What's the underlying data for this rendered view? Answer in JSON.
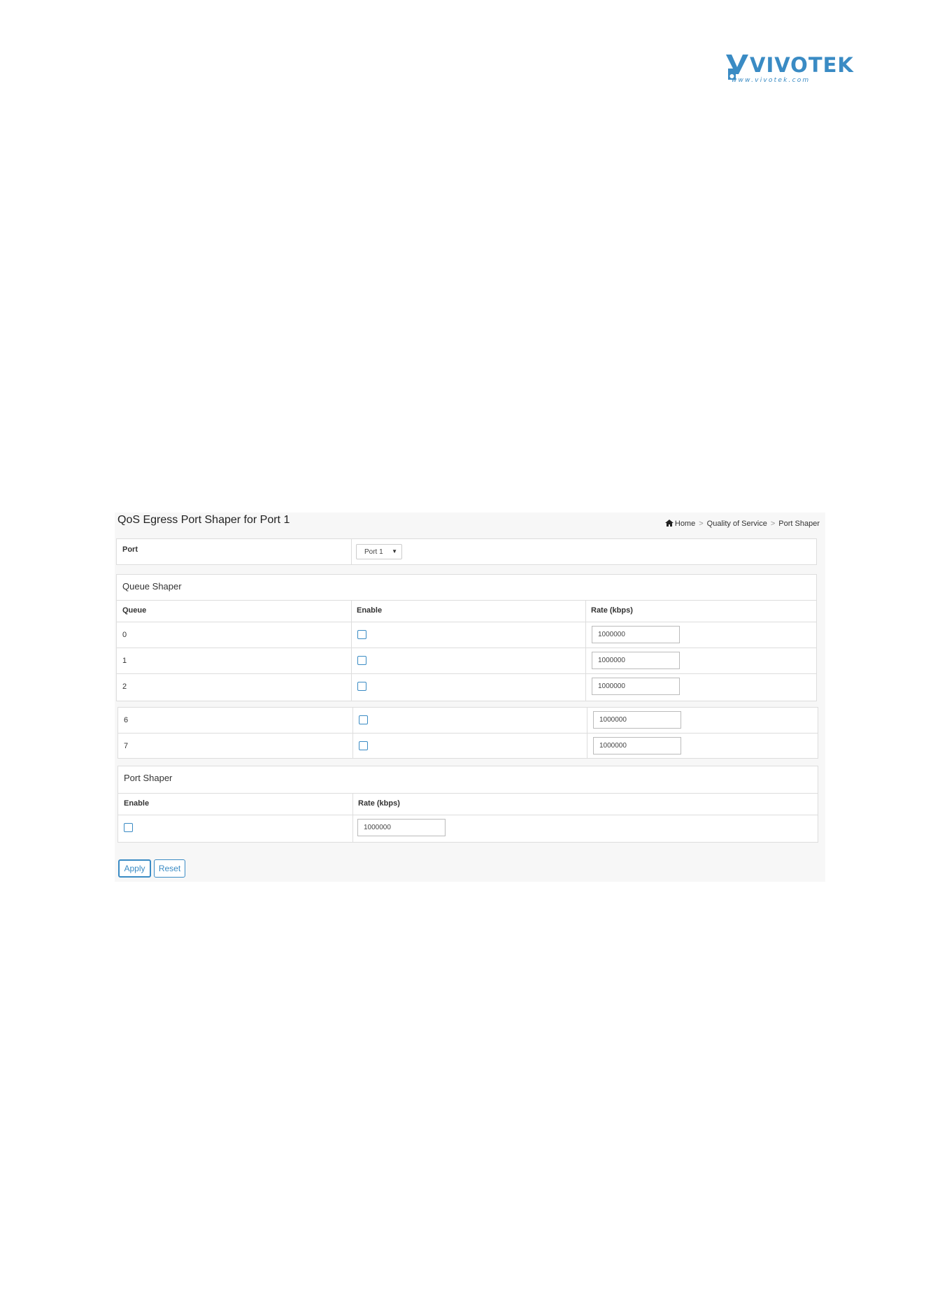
{
  "logo": {
    "brand": "VIVOTEK",
    "url": "www.vivotek.com"
  },
  "page": {
    "title": "QoS Egress Port Shaper for Port 1"
  },
  "breadcrumb": {
    "home": "Home",
    "section": "Quality of Service",
    "current": "Port Shaper"
  },
  "port_selector": {
    "label": "Port",
    "selected": "Port 1"
  },
  "queue_shaper": {
    "title": "Queue Shaper",
    "headers": {
      "queue": "Queue",
      "enable": "Enable",
      "rate": "Rate (kbps)"
    },
    "rows": [
      {
        "queue": "0",
        "enabled": false,
        "rate": "1000000"
      },
      {
        "queue": "1",
        "enabled": false,
        "rate": "1000000"
      },
      {
        "queue": "2",
        "enabled": false,
        "rate": "1000000"
      },
      {
        "queue": "6",
        "enabled": false,
        "rate": "1000000"
      },
      {
        "queue": "7",
        "enabled": false,
        "rate": "1000000"
      }
    ]
  },
  "port_shaper": {
    "title": "Port Shaper",
    "headers": {
      "enable": "Enable",
      "rate": "Rate (kbps)"
    },
    "enabled": false,
    "rate": "1000000"
  },
  "buttons": {
    "apply": "Apply",
    "reset": "Reset"
  },
  "colors": {
    "accent": "#3a8bc4",
    "border": "#dddddd",
    "panel_bg": "#f7f7f7"
  }
}
